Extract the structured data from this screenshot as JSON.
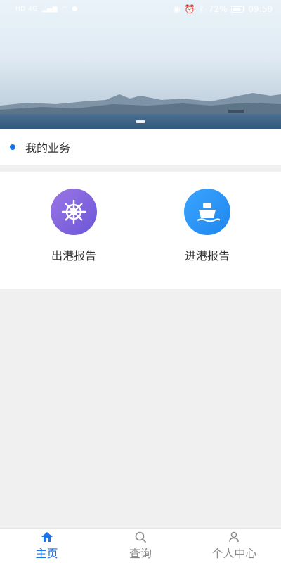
{
  "status_bar": {
    "left_signal": "HD 4G",
    "battery": "72%",
    "time": "09:50"
  },
  "section": {
    "title": "我的业务"
  },
  "services": [
    {
      "label": "出港报告",
      "icon": "ship-wheel-icon"
    },
    {
      "label": "进港报告",
      "icon": "ship-icon"
    }
  ],
  "nav": {
    "items": [
      {
        "label": "主页",
        "icon": "home-icon",
        "active": true
      },
      {
        "label": "查询",
        "icon": "search-icon",
        "active": false
      },
      {
        "label": "个人中心",
        "icon": "person-icon",
        "active": false
      }
    ]
  },
  "colors": {
    "accent": "#1a73e8",
    "outbound": "#7a62dc",
    "inbound": "#2a92f4"
  }
}
